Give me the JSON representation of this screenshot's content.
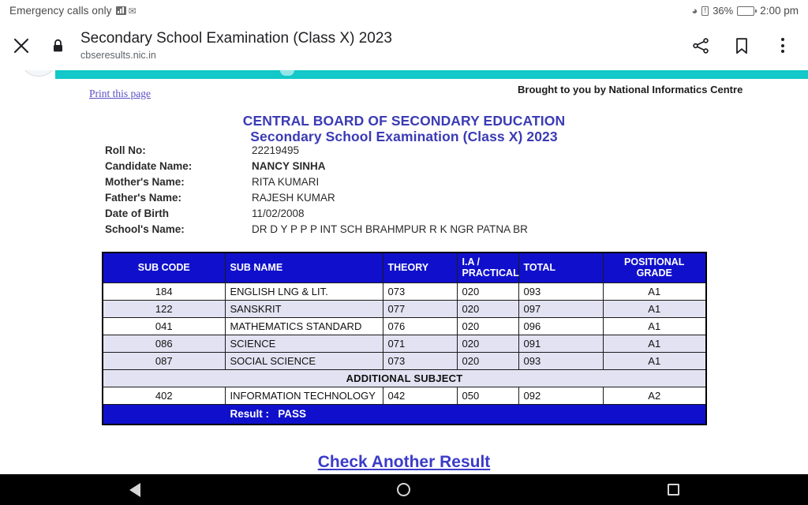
{
  "status_bar": {
    "carrier_text": "Emergency calls only",
    "signal_icon": "signal-bars-icon",
    "gmail_icon": "gmail-icon",
    "wifi_icon": "wifi-icon",
    "battery_warning_icon": "battery-alert-icon",
    "battery_percent": "36%",
    "battery_icon": "battery-icon",
    "clock": "2:00 pm"
  },
  "toolbar": {
    "close_icon": "close-icon",
    "lock_icon": "lock-icon",
    "title": "Secondary School Examination (Class X) 2023",
    "url": "cbseresults.nic.in",
    "share_icon": "share-icon",
    "bookmark_icon": "bookmark-icon",
    "overflow_icon": "more-vertical-icon"
  },
  "page": {
    "print_link": "Print this page",
    "nic_credit": "Brought to you by National Informatics Centre",
    "title_line1": "CENTRAL BOARD OF SECONDARY EDUCATION",
    "title_line2": "Secondary School Examination (Class X) 2023",
    "banner_color": "#12C8C8",
    "header_blue": "#1010CC",
    "alt_row_color": "#E2E2F2",
    "candidate": [
      {
        "label": "Roll No:",
        "value": "22219495",
        "bold": false
      },
      {
        "label": "Candidate Name:",
        "value": "NANCY SINHA",
        "bold": true
      },
      {
        "label": "Mother's Name:",
        "value": "RITA KUMARI",
        "bold": false
      },
      {
        "label": "Father's Name:",
        "value": "RAJESH KUMAR",
        "bold": false
      },
      {
        "label": "Date of Birth",
        "value": "11/02/2008",
        "bold": false
      },
      {
        "label": "School's Name:",
        "value": "DR D Y P P P INT SCH BRAHMPUR R K NGR PATNA BR",
        "bold": false
      }
    ],
    "table": {
      "columns": [
        "SUB CODE",
        "SUB NAME",
        "THEORY",
        "I.A /\nPRACTICAL",
        "TOTAL",
        "POSITIONAL\nGRADE"
      ],
      "col_sub_code": "SUB CODE",
      "col_sub_name": "SUB NAME",
      "col_theory": "THEORY",
      "col_ia_line1": "I.A /",
      "col_ia_line2": "PRACTICAL",
      "col_total": "TOTAL",
      "col_grade_line1": "POSITIONAL",
      "col_grade_line2": "GRADE",
      "rows": [
        {
          "code": "184",
          "name": "ENGLISH LNG & LIT.",
          "theory": "073",
          "ia": "020",
          "total": "093",
          "grade": "A1"
        },
        {
          "code": "122",
          "name": "SANSKRIT",
          "theory": "077",
          "ia": "020",
          "total": "097",
          "grade": "A1"
        },
        {
          "code": "041",
          "name": "MATHEMATICS STANDARD",
          "theory": "076",
          "ia": "020",
          "total": "096",
          "grade": "A1"
        },
        {
          "code": "086",
          "name": "SCIENCE",
          "theory": "071",
          "ia": "020",
          "total": "091",
          "grade": "A1"
        },
        {
          "code": "087",
          "name": "SOCIAL SCIENCE",
          "theory": "073",
          "ia": "020",
          "total": "093",
          "grade": "A1"
        }
      ],
      "additional_subject_label": "ADDITIONAL SUBJECT",
      "additional_rows": [
        {
          "code": "402",
          "name": "INFORMATION TECHNOLOGY",
          "theory": "042",
          "ia": "050",
          "total": "092",
          "grade": "A2"
        }
      ],
      "result_label": "Result :",
      "result_value": "PASS"
    },
    "check_another_link": "Check Another Result"
  },
  "navbar": {
    "back_icon": "back-triangle-icon",
    "home_icon": "home-circle-icon",
    "recents_icon": "recents-square-icon"
  }
}
